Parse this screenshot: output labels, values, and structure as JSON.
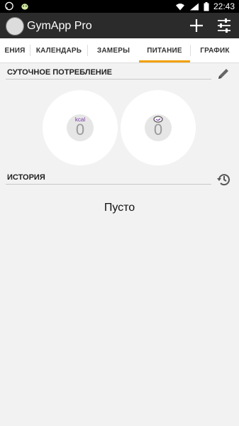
{
  "status_bar": {
    "time": "22:43",
    "left_icons": [
      "whatsapp-icon",
      "android-icon"
    ],
    "right_icons": [
      "wifi-icon",
      "signal-icon",
      "battery-icon"
    ]
  },
  "app_bar": {
    "title": "GymApp Pro",
    "actions": [
      "add-icon",
      "tune-icon"
    ]
  },
  "tabs": [
    {
      "label": "ЕНИЯ"
    },
    {
      "label": "КАЛЕНДАРЬ"
    },
    {
      "label": "ЗАМЕРЫ"
    },
    {
      "label": "ПИТАНИЕ",
      "active": true
    },
    {
      "label": "ГРАФИК"
    }
  ],
  "daily": {
    "title": "СУТОЧНОЕ ПОТРЕБЛЕНИЕ",
    "calories": {
      "unit": "kcal",
      "value": "0"
    },
    "second": {
      "value": "0"
    }
  },
  "history": {
    "title": "ИСТОРИЯ",
    "empty_text": "Пусто"
  },
  "colors": {
    "accent": "#f0a000",
    "appbar": "#2b2b2b",
    "unit_purple": "#7a3aa8"
  }
}
